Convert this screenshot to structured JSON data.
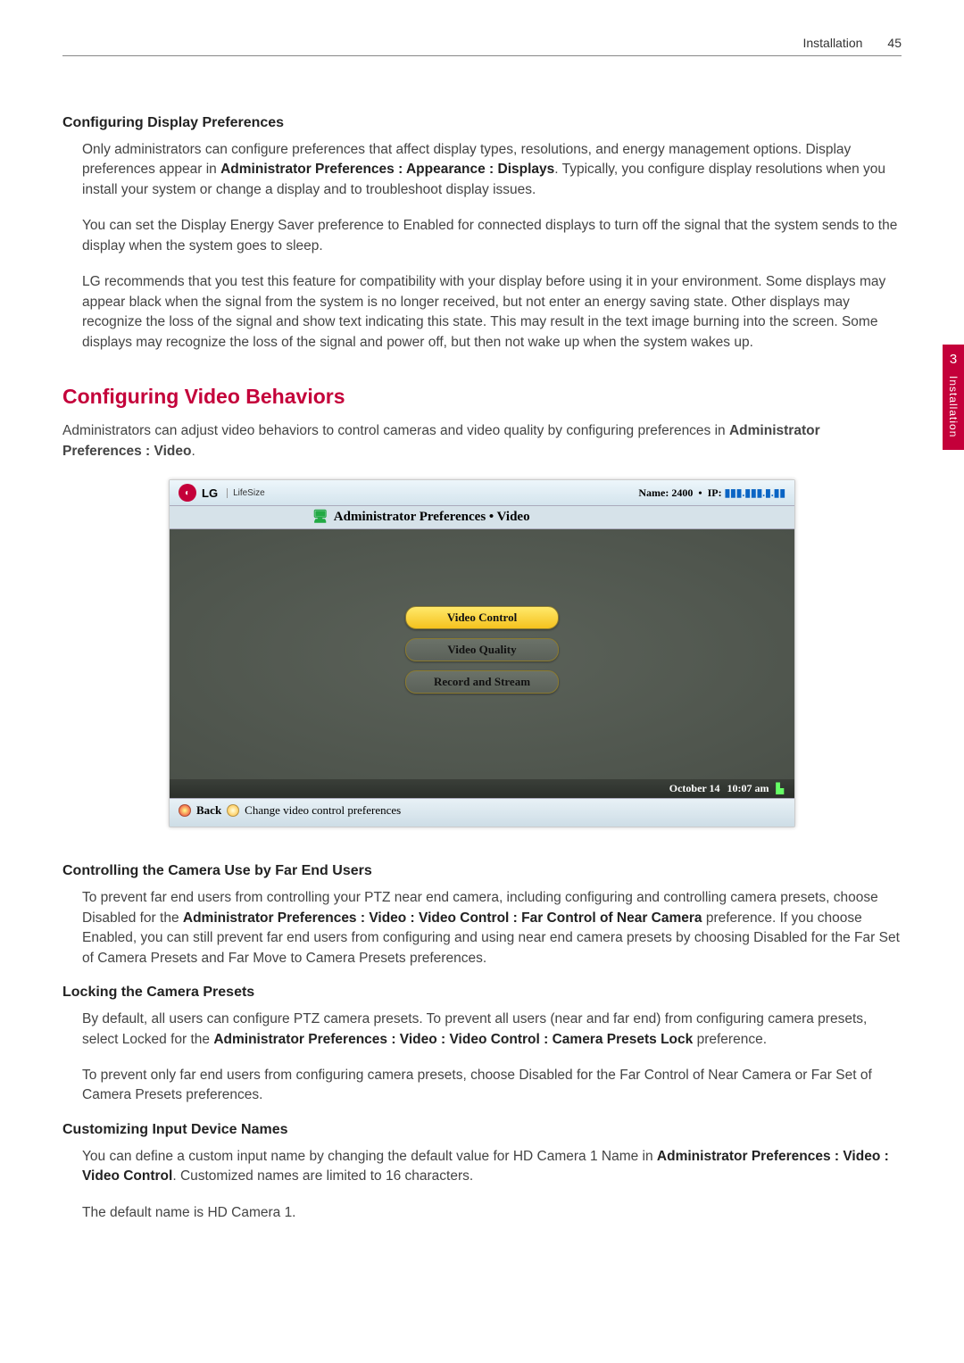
{
  "header": {
    "section": "Installation",
    "page": "45"
  },
  "sideTab": {
    "num": "3",
    "label": "Installation"
  },
  "sec1": {
    "title": "Configuring Display Preferences",
    "p1a": "Only administrators can configure preferences that affect display types, resolutions, and energy management options. Display preferences appear in ",
    "p1b": "Administrator Preferences : Appearance : Displays",
    "p1c": ". Typically, you configure display resolutions when you install your system or change a display and to troubleshoot display issues.",
    "p2": "You can set the Display Energy Saver preference to Enabled for connected displays to turn off the signal that the system sends to the display when the system goes to sleep.",
    "p3": "LG recommends that you test this feature for compatibility with your display before using it in your environment. Some displays may appear black when the signal from the system is no longer received, but not enter an energy saving state. Other displays may recognize the loss of the signal and show text indicating this state. This may result in the text image burning into the screen. Some displays may recognize the loss of the signal and power off, but then not wake up when the system wakes up."
  },
  "sec2": {
    "title": "Configuring Video Behaviors",
    "introA": "Administrators can adjust video behaviors to control cameras and video quality by configuring preferences in ",
    "introB": "Administrator Preferences : Video",
    "introC": "."
  },
  "screenshot": {
    "logoText": "LG",
    "lifesize": "LifeSize",
    "nameLabel": "Name: ",
    "nameValue": "2400",
    "ipLabel": "IP: ",
    "ipValue": "▮▮▮.▮▮▮.▮.▮▮",
    "breadcrumb": "Administrator Preferences • Video",
    "menu": {
      "item1": "Video Control",
      "item2": "Video Quality",
      "item3": "Record and Stream"
    },
    "status": {
      "date": "October 14",
      "time": "10:07 am"
    },
    "footer": {
      "back": "Back",
      "hint": "Change video control preferences"
    }
  },
  "sec3": {
    "title": "Controlling the Camera Use by Far End Users",
    "p1a": "To prevent far end users from controlling your PTZ near end camera, including configuring and controlling camera presets, choose Disabled for the ",
    "p1b": "Administrator Preferences : Video : Video Control : Far Control of Near Camera",
    "p1c": " preference. If you choose Enabled, you can still prevent far end users from configuring and using near end camera presets by choosing Disabled for the Far Set of Camera Presets and Far Move to Camera Presets preferences."
  },
  "sec4": {
    "title": "Locking the Camera Presets",
    "p1a": "By default, all users can configure PTZ camera presets. To prevent all users (near and far end) from configuring camera presets, select Locked for the ",
    "p1b": "Administrator Preferences : Video : Video Control : Camera Presets Lock",
    "p1c": " preference.",
    "p2": "To prevent only far end users from configuring camera presets, choose Disabled for the Far Control of Near Camera or Far Set of Camera Presets preferences."
  },
  "sec5": {
    "title": "Customizing Input Device Names",
    "p1a": "You can define a custom input name by changing the default value for HD Camera 1 Name in ",
    "p1b": "Administrator Preferences : Video : Video Control",
    "p1c": ". Customized names are limited to 16 characters.",
    "p2": "The default name is HD Camera 1."
  }
}
